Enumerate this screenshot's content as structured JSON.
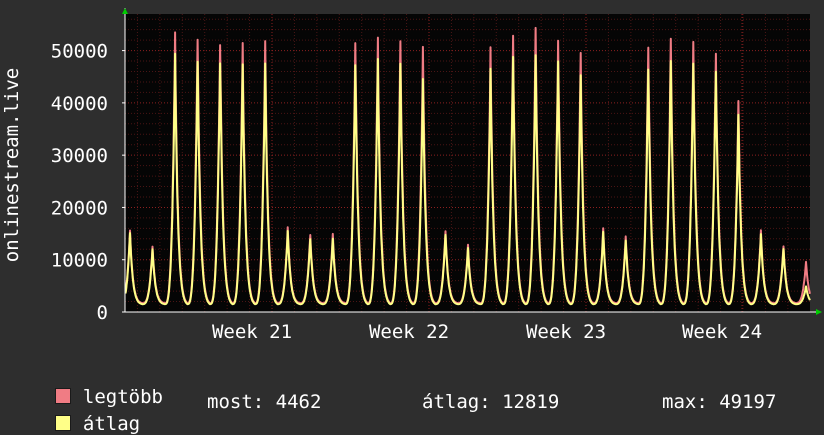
{
  "chart_data": {
    "type": "line",
    "ylabel": "onlinestream.live",
    "ylim": [
      0,
      57000
    ],
    "yticks": [
      0,
      10000,
      20000,
      30000,
      40000,
      50000
    ],
    "xlabels": [
      "Week 21",
      "Week 22",
      "Week 23",
      "Week 24"
    ],
    "series": [
      {
        "name": "legtöbb",
        "color": "#f07c84",
        "daily_peaks": [
          15300,
          12300,
          52200,
          52000,
          51000,
          50300,
          50800,
          16000,
          14700,
          14700,
          51000,
          51200,
          50700,
          49500,
          15300,
          12500,
          49200,
          52200,
          53100,
          51400,
          48700,
          15800,
          14300,
          50400,
          51400,
          51100,
          49000,
          39600,
          15200,
          12500,
          9400
        ]
      },
      {
        "name": "átlag",
        "color": "#ffff88",
        "daily_peaks": [
          14800,
          11800,
          48200,
          47800,
          47500,
          46300,
          46600,
          15300,
          13900,
          13800,
          46800,
          47200,
          46500,
          43500,
          14600,
          11900,
          45200,
          48200,
          48000,
          47500,
          44500,
          15100,
          13500,
          46200,
          47200,
          47000,
          45600,
          37000,
          14500,
          12000,
          4800
        ]
      }
    ]
  },
  "legend": [
    {
      "label": "legtöbb",
      "color": "#f07c84"
    },
    {
      "label": "átlag",
      "color": "#ffff88"
    }
  ],
  "stats": {
    "most": "most: 4462",
    "atlag": "átlag: 12819",
    "max": "max: 49197"
  },
  "colors": {
    "background": "#2e2e2e",
    "plot_background": "#050505",
    "grid": "#8c2020",
    "axis": "#ffffff",
    "arrow": "#00cc00"
  }
}
